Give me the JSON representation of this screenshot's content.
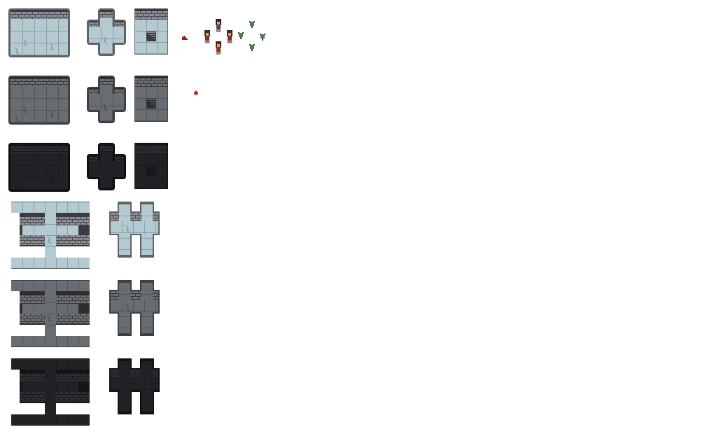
{
  "sprite_sheet": {
    "background": "#ffffff",
    "palettes": {
      "light": {
        "wall_top": "#3b3b3f",
        "brick": "#8c8c94",
        "brick_mortar": "#4a4a50",
        "floor": "#b5c9d1",
        "floor_line": "#87a1ab",
        "rim": "#616168",
        "crack": "#6d8894"
      },
      "mid": {
        "wall_top": "#2e2e32",
        "brick": "#6e6e73",
        "brick_mortar": "#3a3a3e",
        "floor": "#686d72",
        "floor_line": "#50555a",
        "rim": "#3f3f44",
        "crack": "#41464b"
      },
      "dark": {
        "wall_top": "#151517",
        "brick": "#2e2e32",
        "brick_mortar": "#1a1a1d",
        "floor": "#222226",
        "floor_line": "#1a1a1d",
        "rim": "#101012",
        "crack": "#18181b"
      }
    },
    "tile_rows": [
      {
        "palette": "light",
        "tiles": [
          "room-tile",
          "cross-tile",
          "stairs-tile"
        ]
      },
      {
        "palette": "mid",
        "tiles": [
          "room-tile",
          "cross-tile",
          "stairs-tile"
        ]
      },
      {
        "palette": "dark",
        "tiles": [
          "room-tile",
          "cross-tile",
          "stairs-tile"
        ]
      },
      {
        "palette": "light",
        "tiles": [
          "i-beam-tile",
          "h-tile"
        ]
      },
      {
        "palette": "mid",
        "tiles": [
          "i-beam-tile",
          "h-tile"
        ]
      },
      {
        "palette": "dark",
        "tiles": [
          "i-beam-tile",
          "h-tile"
        ]
      }
    ],
    "characters": [
      {
        "name": "hero-down",
        "hair": "#3a2a22",
        "skin": "#d6a37a",
        "body": "#8a2d22"
      },
      {
        "name": "hero-up",
        "hair": "#2a2222",
        "skin": "#d6a37a",
        "body": "#4a4a4a"
      },
      {
        "name": "hero-right",
        "hair": "#3a2a22",
        "skin": "#d6a37a",
        "body": "#8a2d22"
      },
      {
        "name": "hero-left",
        "hair": "#3a2a22",
        "skin": "#d6a37a",
        "body": "#8a2d22"
      }
    ],
    "goblins": {
      "color": "#4f7a52",
      "accent": "#2f4d33"
    },
    "items": [
      {
        "name": "blood-splat",
        "color": "#9c1b1b"
      },
      {
        "name": "potion",
        "color": "#c62a2a"
      }
    ]
  }
}
